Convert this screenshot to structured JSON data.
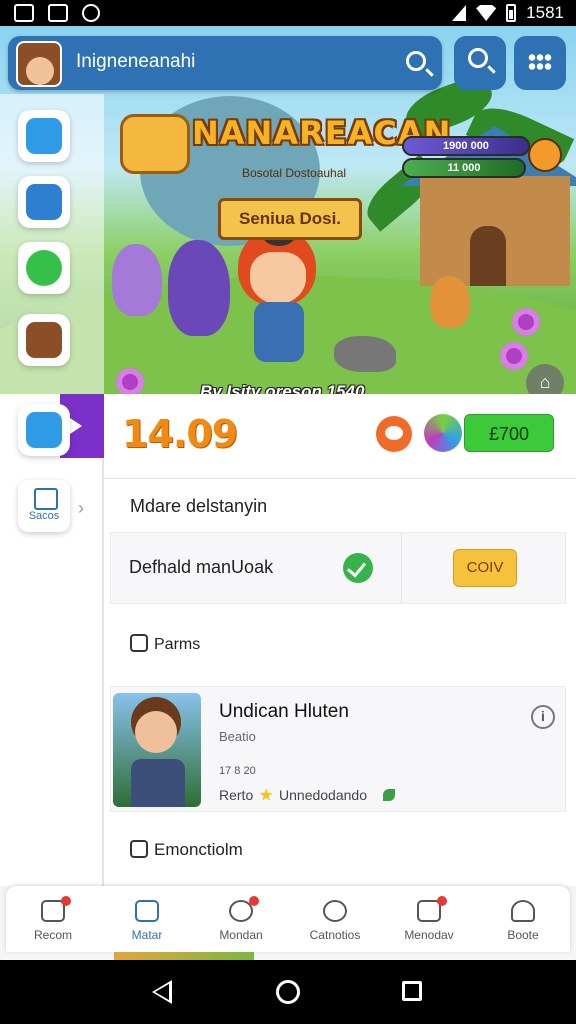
{
  "status_bar": {
    "time": "1581"
  },
  "app_bar": {
    "title": "Inigneneanahi"
  },
  "hero": {
    "game_title": "NANAREACAN",
    "game_subtitle": "Bosotal Dostoauhal",
    "ribbon": "Seniua Dosi.",
    "caption": "By Isity oreson 1540",
    "xp_value": "1900 000",
    "gems_value": "11 000"
  },
  "summary": {
    "score": "14.09",
    "price_label": "£700"
  },
  "sections": {
    "section_one_title": "Mdare delstanyin",
    "row_label": "Defhald manUoak",
    "row_button": "COIV",
    "params_title": "Parms",
    "last_title": "Emonctiolm"
  },
  "card": {
    "title": "Undican Hluten",
    "subtitle": "Beatio",
    "meta": "17 8 20",
    "footer_prefix": "Rerto",
    "footer_text": "Unnedodando",
    "info_glyph": "i"
  },
  "rail": {
    "label": "Sacos"
  },
  "bottom_nav": [
    {
      "label": "Recom",
      "badge": true
    },
    {
      "label": "Matar",
      "badge": false,
      "active": true
    },
    {
      "label": "Mondan",
      "badge": true
    },
    {
      "label": "Catnotios",
      "badge": false
    },
    {
      "label": "Menodav",
      "badge": true
    },
    {
      "label": "Boote",
      "badge": false
    }
  ],
  "colors": {
    "brand": "#2f72b3",
    "score": "#f08a12",
    "accent_green": "#3cc93a",
    "accent_yellow": "#f6c23d"
  }
}
